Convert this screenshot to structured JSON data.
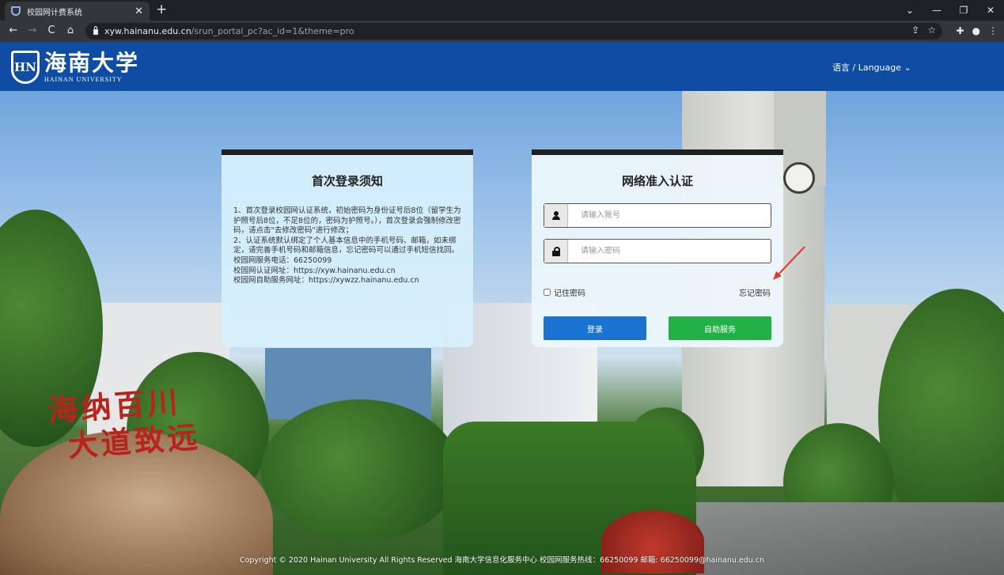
{
  "browser": {
    "tab_title": "校园网计费系统",
    "tab_close": "✕",
    "new_tab": "+",
    "url_host": "xyw.hainanu.edu.cn",
    "url_path": "/srun_portal_pc?ac_id=1&theme=pro",
    "back": "←",
    "forward": "→",
    "reload": "C",
    "home": "⌂",
    "window_buttons": [
      "⌄",
      "—",
      "❐",
      "✕"
    ]
  },
  "header": {
    "logo_mark": "HN",
    "logo_cn": "海南大学",
    "logo_en": "HAINAN UNIVERSITY",
    "language": "语言 / Language ⌄"
  },
  "scene": {
    "rock_text_line1": "海纳百川",
    "rock_text_line2": "大道致远"
  },
  "notice": {
    "title": "首次登录须知",
    "lines": [
      "1、首次登录校园网认证系统，初始密码为身份证号后8位（留学生为护照号后8位，不足8位的，密码为护照号。），首次登录会强制修改密码，请点击\"去修改密码\"进行修改；",
      "2、认证系统默认绑定了个人基本信息中的手机号码、邮箱，如未绑定，请完善手机号码和邮箱信息，忘记密码可以通过手机短信找回。",
      "校园网服务电话：66250099",
      "校园网认证网址：https://xyw.hainanu.edu.cn",
      "校园网自助服务网址：https://xywzz.hainanu.edu.cn"
    ]
  },
  "login": {
    "title": "网络准入认证",
    "username_placeholder": "请输入账号",
    "password_placeholder": "请输入密码",
    "remember_label": "记住密码",
    "forgot_label": "忘记密码",
    "login_button": "登录",
    "self_service_button": "自助服务"
  },
  "footer": {
    "text": "Copyright © 2020 Hainan University All Rights Reserved 海南大学信息化服务中心 校园网服务热线：66250099 邮箱: 66250099@hainanu.edu.cn"
  },
  "colors": {
    "header_bg": "#0f4ca3",
    "login_button": "#1a73d1",
    "self_service_button": "#22b147",
    "annotation_arrow": "#e03a2f"
  }
}
